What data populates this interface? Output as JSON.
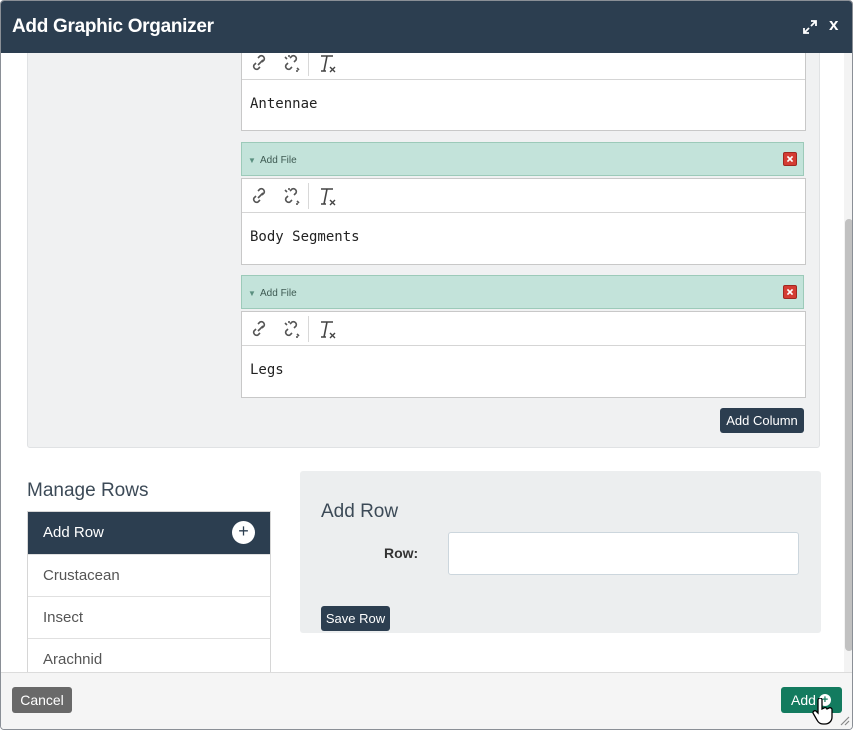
{
  "window": {
    "title": "Add Graphic Organizer",
    "close_label": "x"
  },
  "columns": [
    {
      "text": "Antennae"
    },
    {
      "file_label": "Add File",
      "text": "Body Segments"
    },
    {
      "file_label": "Add File",
      "text": "Legs"
    }
  ],
  "toolbar_icons": [
    "link-icon",
    "unlink-icon",
    "remove-format-icon"
  ],
  "add_column_label": "Add Column",
  "manage_rows": {
    "title": "Manage Rows",
    "header_label": "Add Row",
    "items": [
      "Crustacean",
      "Insect",
      "Arachnid"
    ]
  },
  "add_row_form": {
    "heading": "Add Row",
    "row_label": "Row:",
    "row_value": "",
    "save_label": "Save Row"
  },
  "footer": {
    "cancel_label": "Cancel",
    "add_label": "Add"
  },
  "colors": {
    "header": "#2c3e50",
    "file_bar": "#c3e3da",
    "add_button": "#137b5f",
    "delete": "#d43c33"
  }
}
